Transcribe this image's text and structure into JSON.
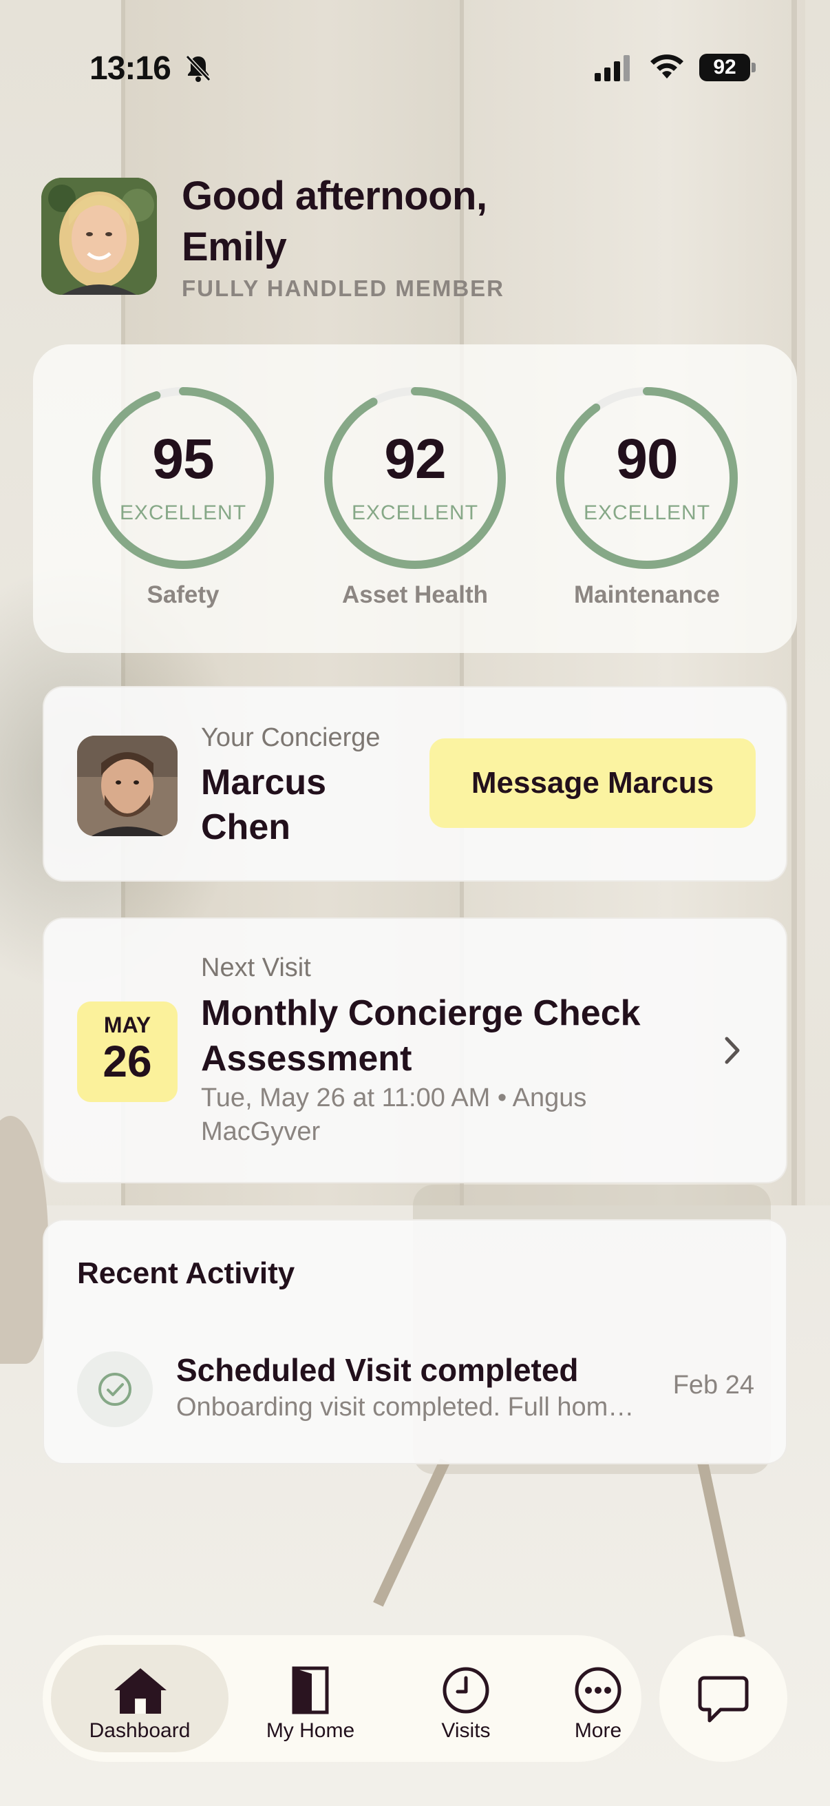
{
  "status_bar": {
    "time": "13:16",
    "battery": "92",
    "icons": [
      "bell-slash-icon",
      "signal-icon",
      "wifi-icon",
      "battery-icon"
    ]
  },
  "header": {
    "greeting_line1": "Good afternoon,",
    "greeting_line2": "Emily",
    "membership": "FULLY HANDLED MEMBER"
  },
  "scores": [
    {
      "value": "95",
      "status": "EXCELLENT",
      "label": "Safety",
      "progress": 0.95
    },
    {
      "value": "92",
      "status": "EXCELLENT",
      "label": "Asset Health",
      "progress": 0.92
    },
    {
      "value": "90",
      "status": "EXCELLENT",
      "label": "Maintenance",
      "progress": 0.9
    }
  ],
  "concierge": {
    "label": "Your Concierge",
    "name_line1": "Marcus",
    "name_line2": "Chen",
    "button": "Message Marcus"
  },
  "next_visit": {
    "label": "Next Visit",
    "month": "MAY",
    "day": "26",
    "title_line1": "Monthly Concierge Check",
    "title_line2": "Assessment",
    "detail_line1": "Tue, May 26 at 11:00 AM • Angus",
    "detail_line2": "MacGyver"
  },
  "recent_activity": {
    "heading": "Recent Activity",
    "items": [
      {
        "title": "Scheduled Visit completed",
        "description": "Onboarding visit completed. Full home assessment done.",
        "date": "Feb 24",
        "icon": "check-circle-icon"
      }
    ]
  },
  "tabs": [
    {
      "label": "Dashboard",
      "icon": "house-icon",
      "active": true
    },
    {
      "label": "My Home",
      "icon": "door-icon",
      "active": false
    },
    {
      "label": "Visits",
      "icon": "clock-icon",
      "active": false
    },
    {
      "label": "More",
      "icon": "more-icon",
      "active": false
    }
  ],
  "chat_icon": "chat-bubble-icon",
  "colors": {
    "accent_green": "#86a887",
    "button_yellow": "#fbf3a1",
    "text_dark": "#22101c"
  }
}
